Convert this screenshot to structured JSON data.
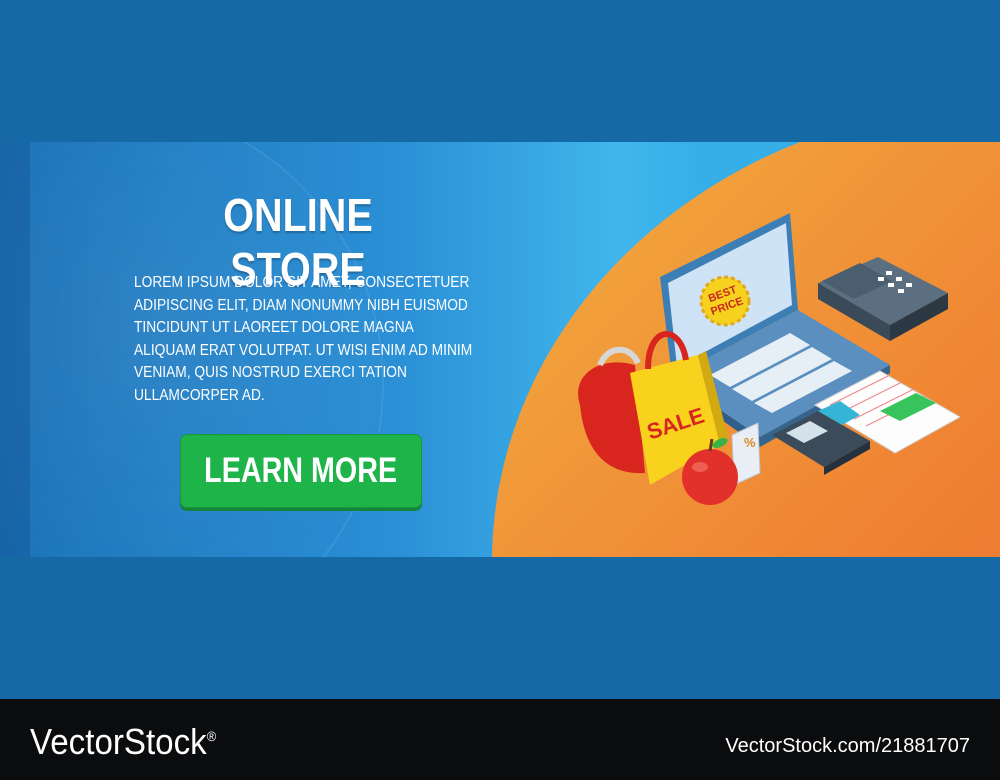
{
  "banner": {
    "title": "ONLINE STORE",
    "body": "LOREM IPSUM DOLOR SIT AMET, CONSECTETUER ADIPISCING ELIT, DIAM NONUMMY NIBH EUISMOD TINCIDUNT UT LAOREET DOLORE MAGNA ALIQUAM ERAT VOLUTPAT. UT WISI ENIM AD MINIM VENIAM, QUIS NOSTRUD EXERCI TATION ULLAMCORPER AD.",
    "cta_label": "LEARN MORE",
    "badge_text_1": "BEST",
    "badge_text_2": "PRICE",
    "bag_text": "SALE",
    "calculator_symbol": "%",
    "colors": {
      "cta": "#1eb44a",
      "orange_start": "#f2b040",
      "orange_end": "#ea5f2a",
      "blue": "#156aa5"
    }
  },
  "watermark": {
    "logo": "VectorStock",
    "registered": "®",
    "image_id": "VectorStock.com/21881707"
  }
}
